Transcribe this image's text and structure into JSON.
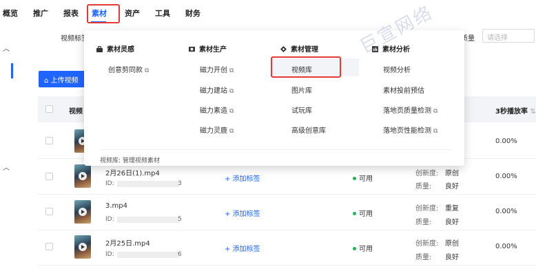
{
  "topnav": {
    "items": [
      "概览",
      "推广",
      "报表",
      "素材",
      "资产",
      "工具",
      "财务"
    ],
    "active_index": 3
  },
  "filters": {
    "video_tag_label": "视频标签",
    "quality_label": "质量",
    "quality_placeholder": "请选择"
  },
  "toolbar": {
    "upload_label": "上传视频"
  },
  "table": {
    "headers": {
      "video": "视频",
      "play_rate_3s": "3秒播放率"
    },
    "rows": [
      {
        "name": "",
        "id_prefix": "",
        "id_suffix": "",
        "tag_action": "",
        "status": "",
        "originality_label": "",
        "originality": "",
        "quality_label": "",
        "quality": "",
        "rate": "0.00%"
      },
      {
        "name": "2月26日(1).mp4",
        "id_prefix": "ID:",
        "id_suffix": "3",
        "tag_action": "+ 添加标签",
        "status": "可用",
        "originality_label": "创新度:",
        "originality": "原创",
        "quality_label": "质量:",
        "quality": "良好",
        "rate": "0.00%"
      },
      {
        "name": "3.mp4",
        "id_prefix": "ID:",
        "id_suffix": "5",
        "tag_action": "+ 添加标签",
        "status": "可用",
        "originality_label": "创新度:",
        "originality": "重复",
        "quality_label": "质量:",
        "quality": "良好",
        "rate": "0.00%"
      },
      {
        "name": "2月25日.mp4",
        "id_prefix": "ID:",
        "id_suffix": "6",
        "tag_action": "+ 添加标签",
        "status": "可用",
        "originality_label": "创新度:",
        "originality": "原创",
        "quality_label": "质量:",
        "quality": "良好",
        "rate": "0.00%"
      }
    ]
  },
  "dropdown": {
    "columns": [
      {
        "title": "素材灵感",
        "icon": "toolbox-icon",
        "items": [
          "创意剪同款"
        ]
      },
      {
        "title": "素材生产",
        "icon": "film-icon",
        "items": [
          "磁力开创",
          "磁力建站",
          "磁力素造",
          "磁力灵鹿"
        ]
      },
      {
        "title": "素材管理",
        "icon": "diamond-icon",
        "items": [
          "视频库",
          "图片库",
          "试玩库",
          "高级创意库"
        ]
      },
      {
        "title": "素材分析",
        "icon": "chart-icon",
        "items": [
          "视频分析",
          "素材投前预估",
          "落地页质量检测",
          "落地页性能检测"
        ]
      }
    ],
    "external_flags": {
      "inspiration": [
        true
      ],
      "production": [
        true,
        true,
        true,
        true
      ],
      "analysis": [
        false,
        false,
        true,
        true
      ]
    },
    "selected": "视频库",
    "footer": "视频库: 管理视频素材"
  },
  "watermark": "巨宣网络",
  "colors": {
    "accent": "#1f64ff",
    "highlight": "#e53935",
    "success": "#23b35a"
  }
}
